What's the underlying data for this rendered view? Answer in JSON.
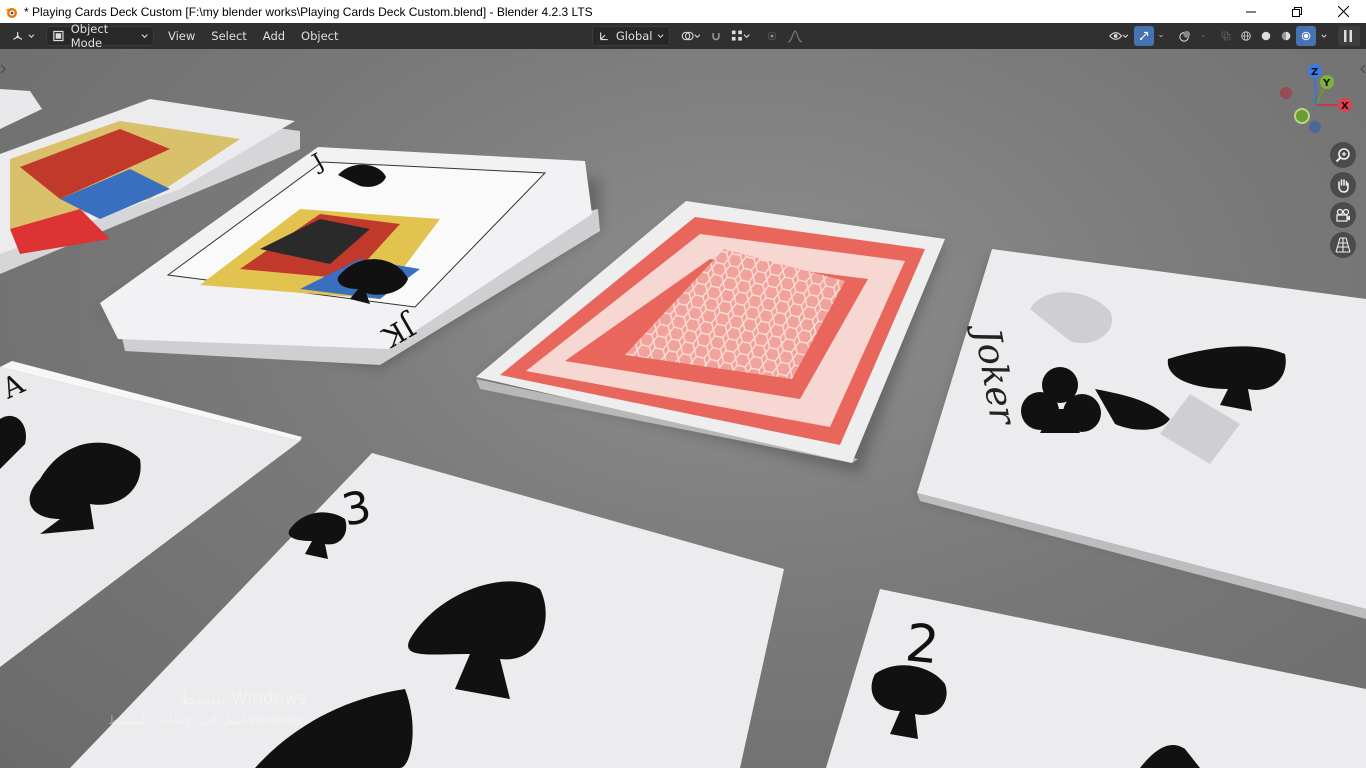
{
  "window": {
    "title": "* Playing Cards Deck Custom [F:\\my blender works\\Playing Cards Deck Custom.blend] - Blender 4.2.3 LTS",
    "controls": [
      "minimize",
      "restore",
      "close"
    ]
  },
  "header": {
    "editor_type_icon": "editor-type-icon",
    "mode": "Object Mode",
    "menus": [
      "View",
      "Select",
      "Add",
      "Object"
    ],
    "transform_orientation": "Global",
    "pivot_icon": "pivot-icon",
    "snap_icon": "snap-magnet-icon",
    "snap_target_icon": "snap-grid-icon",
    "proportional_icon": "proportional-edit-icon",
    "falloff_icon": "falloff-curve-icon",
    "visibility_icon": "eye-icon",
    "gizmo_icon": "gizmo-icon",
    "overlay_icon": "overlay-icon",
    "xray_icon": "xray-icon",
    "shading_modes": [
      "wireframe",
      "solid",
      "material-preview",
      "rendered"
    ],
    "active_shading": "rendered",
    "colors": {
      "header_bg": "#303030",
      "active": "#4772b3",
      "text": "#e0e0e0"
    }
  },
  "viewport": {
    "axes": {
      "x": "X",
      "y": "Y",
      "z": "Z"
    },
    "nav_buttons": [
      "zoom-icon",
      "hand-pan-icon",
      "camera-icon",
      "perspective-grid-icon"
    ],
    "cards": {
      "jack": {
        "rank": "J",
        "label": "JK"
      },
      "three": {
        "rank": "3"
      },
      "two": {
        "rank": "2"
      },
      "ace": {
        "rank": "A"
      },
      "joker": {
        "label": "Joker"
      }
    },
    "colors": {
      "card_back": "#e8665c",
      "card_face": "#e9e9ec",
      "table": "#7e7e7e"
    }
  },
  "watermark": {
    "line1": "تنشيط Windows",
    "line2": "انتقل إلى الإعدادات لتنشيط Windows."
  }
}
